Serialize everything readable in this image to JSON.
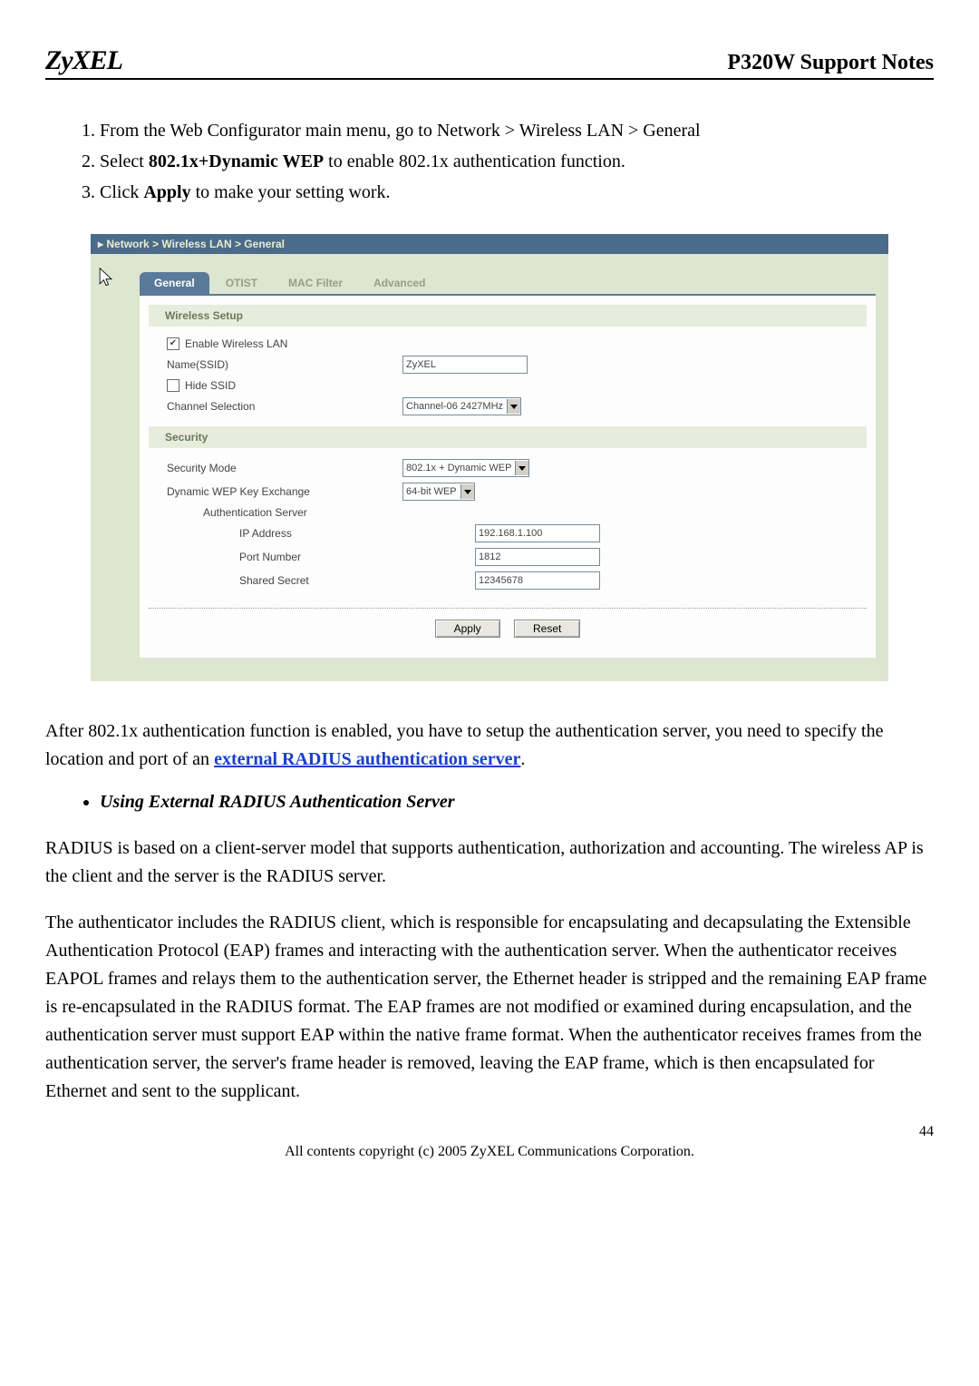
{
  "header": {
    "logo": "ZyXEL",
    "title": "P320W Support Notes"
  },
  "steps": [
    {
      "pre": "From the Web Configurator main menu, go to Network > Wireless LAN > General",
      "bold": "",
      "post": ""
    },
    {
      "pre": "Select ",
      "bold": "802.1x+Dynamic WEP",
      "post": " to enable 802.1x authentication function."
    },
    {
      "pre": "Click ",
      "bold": "Apply",
      "post": " to make your setting work."
    }
  ],
  "shot": {
    "breadcrumb": "Network > Wireless LAN > General",
    "tabs": {
      "general": "General",
      "otist": "OTIST",
      "macfilter": "MAC Filter",
      "advanced": "Advanced"
    },
    "section_wireless": "Wireless Setup",
    "section_security": "Security",
    "labels": {
      "enable": "Enable Wireless LAN",
      "ssid": "Name(SSID)",
      "hide": "Hide SSID",
      "channel": "Channel Selection",
      "secmode": "Security Mode",
      "dynwep": "Dynamic WEP Key Exchange",
      "authserver": "Authentication Server",
      "ip": "IP Address",
      "port": "Port Number",
      "secret": "Shared Secret"
    },
    "values": {
      "ssid": "ZyXEL",
      "channel": "Channel-06 2427MHz",
      "secmode": "802.1x + Dynamic WEP",
      "dynwep": "64-bit WEP",
      "ip": "192.168.1.100",
      "port": "1812",
      "secret": "12345678"
    },
    "buttons": {
      "apply": "Apply",
      "reset": "Reset"
    }
  },
  "para_after_pre": "After 802.1x authentication function is enabled, you have to setup the authentication server, you need to specify the location and port of an ",
  "para_after_link": "external RADIUS authentication server",
  "para_after_post": ".",
  "bullet": "Using External RADIUS Authentication Server",
  "para_radius1": "RADIUS is based on a client-server model that supports authentication, authorization and accounting. The wireless AP is the client and the server is the RADIUS server.",
  "para_radius2": "The authenticator includes the RADIUS client, which is responsible for encapsulating and decapsulating the Extensible Authentication Protocol (EAP) frames and interacting with the authentication server. When the authenticator receives EAPOL frames and relays them to the authentication server, the Ethernet header is stripped and the remaining EAP frame is re-encapsulated in the RADIUS format. The EAP frames are not modified or examined during encapsulation, and the authentication server must support EAP within the native frame format. When the authenticator receives frames from the authentication server, the server's frame header is removed, leaving the EAP frame, which is then encapsulated for Ethernet and sent to the supplicant.",
  "pagenum": "44",
  "footer": "All contents copyright (c) 2005 ZyXEL Communications Corporation."
}
